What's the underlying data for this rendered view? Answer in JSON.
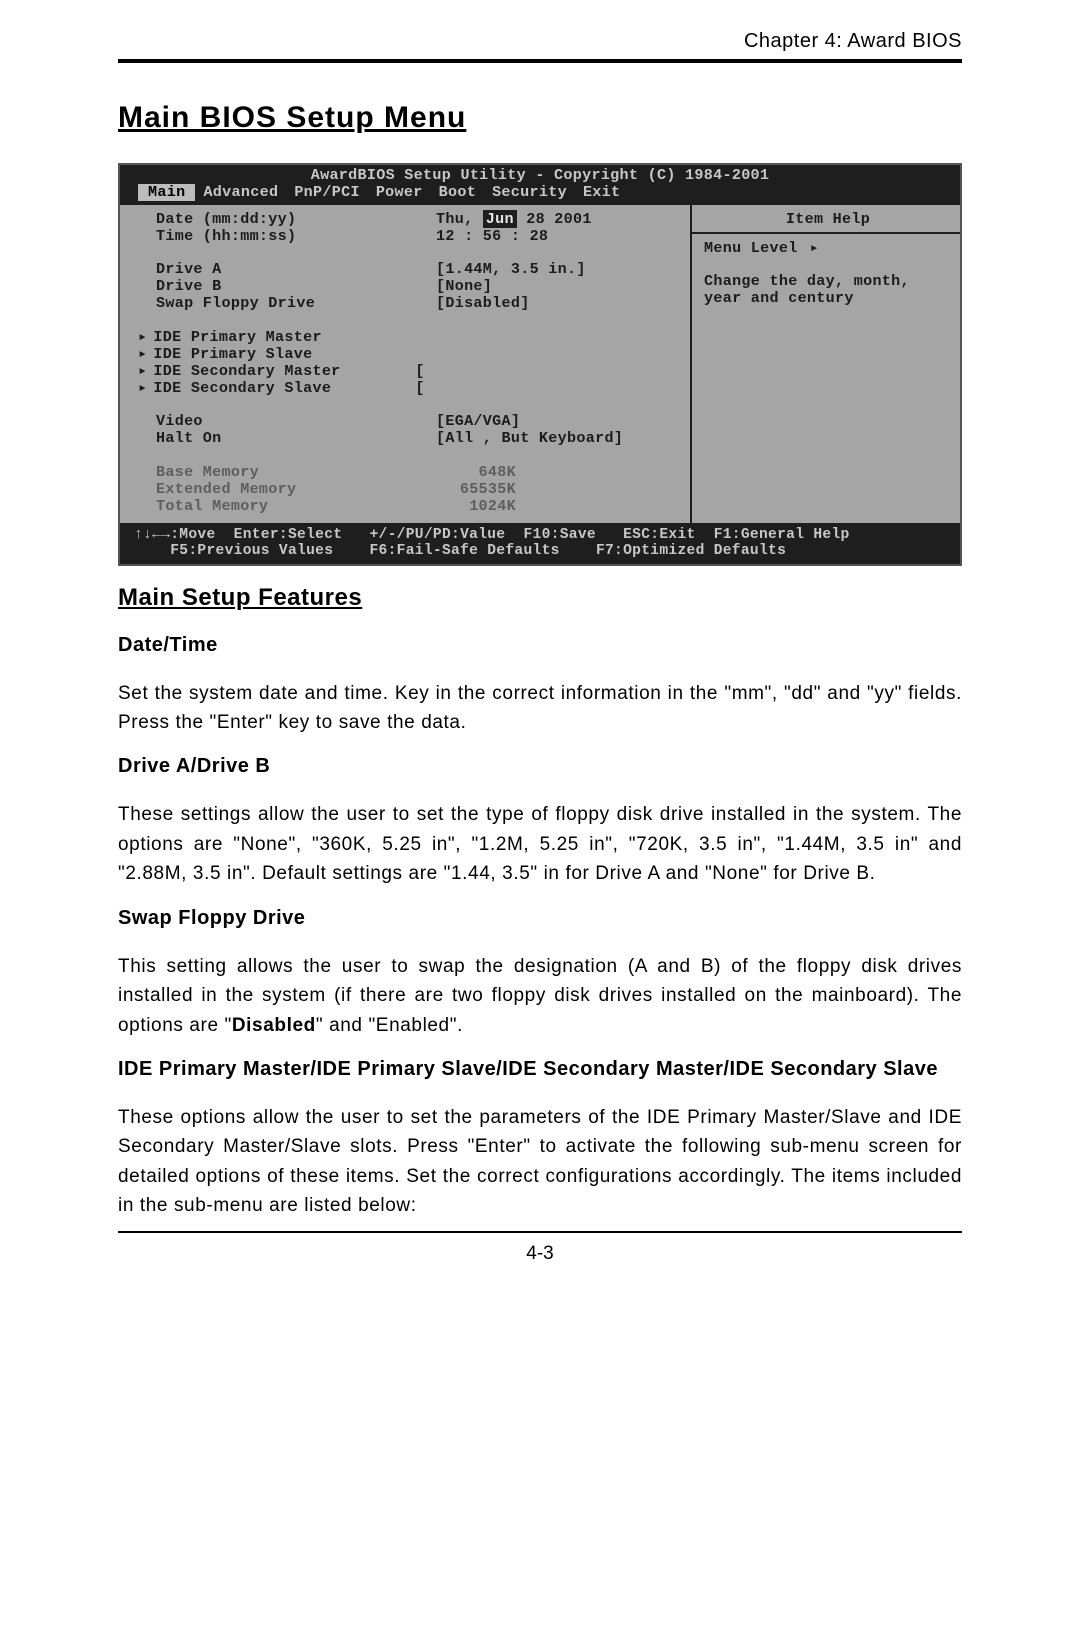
{
  "chapter_header": "Chapter 4: Award BIOS",
  "page_number": "4-3",
  "h1": "Main BIOS Setup Menu",
  "h2": "Main Setup Features",
  "sections": {
    "date_time": {
      "title": "Date/Time",
      "body": "Set the system date and time.  Key in the correct information in the \"mm\", \"dd\" and \"yy\" fields.  Press the \"Enter\" key to save the data."
    },
    "drive_ab": {
      "title": "Drive A/Drive B",
      "body": "These settings allow the user to set the type of floppy disk drive installed in the system.  The options are \"None\", \"360K, 5.25 in\", \"1.2M, 5.25 in\", \"720K, 3.5 in\", \"1.44M, 3.5 in\" and \"2.88M, 3.5 in\".  Default settings are \"1.44, 3.5\" in for Drive A and \"None\" for Drive B."
    },
    "swap": {
      "title": "Swap Floppy Drive",
      "body_pre": "This setting allows the user to swap the designation (A and B) of the floppy disk drives installed in the system (if there are two floppy disk drives installed on the mainboard).  The options are \"",
      "body_bold": "Disabled",
      "body_post": "\" and \"Enabled\"."
    },
    "ide": {
      "title": "IDE Primary Master/IDE Primary Slave/IDE Secondary Master/IDE Secondary Slave",
      "body": "These options allow the user to set the parameters of the IDE Primary Master/Slave and IDE Secondary Master/Slave slots.  Press \"Enter\" to activate  the following sub-menu screen for detailed options of these items.  Set the correct configurations accordingly.  The items included in the sub-menu are listed below:"
    }
  },
  "bios": {
    "title": "AwardBIOS Setup Utility - Copyright (C) 1984-2001",
    "tabs": [
      "Main",
      "Advanced",
      "PnP/PCI",
      "Power",
      "Boot",
      "Security",
      "Exit"
    ],
    "active_tab": "Main",
    "help": {
      "title": "Item Help",
      "menu_level": "Menu Level",
      "desc1": "Change the day, month,",
      "desc2": "year and century"
    },
    "left": {
      "date_label": "Date (mm:dd:yy)",
      "date_val_pre": "Thu, ",
      "date_val_sel": "Jun",
      "date_val_post": " 28 2001",
      "time_label": "Time (hh:mm:ss)",
      "time_val": "12 : 56 : 28",
      "driveA_label": "Drive A",
      "driveA_val": "[1.44M, 3.5 in.]",
      "driveB_label": "Drive B",
      "driveB_val": "[None]",
      "swap_label": "Swap Floppy Drive",
      "swap_val": "[Disabled]",
      "ide_pm": "IDE Primary Master",
      "ide_ps": "IDE Primary Slave",
      "ide_sm": "IDE Secondary Master",
      "ide_ss": "IDE Secondary Slave",
      "ide_sm_val": "[",
      "ide_ss_val": "[",
      "video_label": "Video",
      "video_val": "[EGA/VGA]",
      "halt_label": "Halt On",
      "halt_val": "[All , But Keyboard]",
      "base_label": "Base Memory",
      "base_val": "  648K",
      "ext_label": "Extended Memory",
      "ext_val": "65535K",
      "total_label": "Total Memory",
      "total_val": " 1024K"
    },
    "footer_line1": "↑↓←→:Move  Enter:Select   +/-/PU/PD:Value  F10:Save   ESC:Exit  F1:General Help",
    "footer_line2": "    F5:Previous Values    F6:Fail-Safe Defaults    F7:Optimized Defaults"
  }
}
